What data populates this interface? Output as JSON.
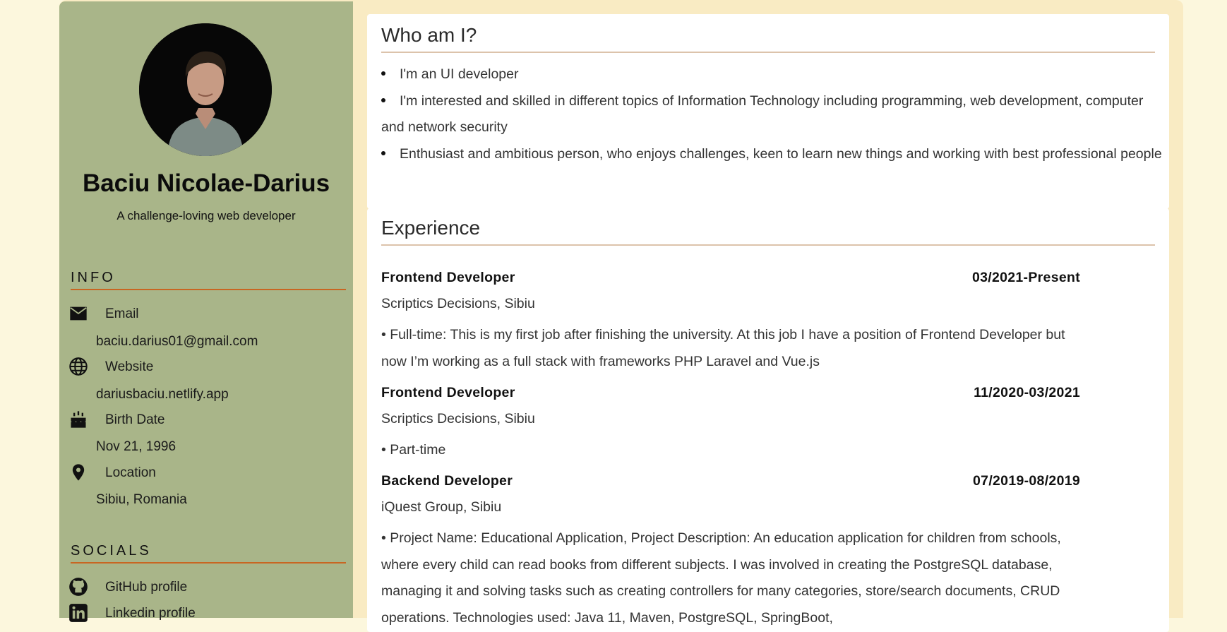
{
  "profile": {
    "name": "Baciu Nicolae-Darius",
    "tagline": "A challenge-loving web developer"
  },
  "info": {
    "title": "INFO",
    "items": [
      {
        "icon": "mail-icon",
        "label": "Email",
        "value": "baciu.darius01@gmail.com"
      },
      {
        "icon": "globe-icon",
        "label": "Website",
        "value": "dariusbaciu.netlify.app"
      },
      {
        "icon": "cake-icon",
        "label": "Birth Date",
        "value": "Nov 21, 1996"
      },
      {
        "icon": "location-pin-icon",
        "label": "Location",
        "value": "Sibiu, Romania"
      }
    ]
  },
  "socials": {
    "title": "SOCIALS",
    "items": [
      {
        "icon": "github-icon",
        "label": "GitHub profile"
      },
      {
        "icon": "linkedin-icon",
        "label": "Linkedin profile"
      }
    ]
  },
  "about": {
    "title": "Who am I?",
    "bullets": [
      "I'm an UI developer",
      "I'm interested and skilled in different topics of Information Technology including programming, web development, computer and network security",
      "Enthusiast and ambitious person, who enjoys challenges, keen to learn new things and working with best professional people"
    ]
  },
  "experience": {
    "title": "Experience",
    "jobs": [
      {
        "title": "Frontend Developer",
        "date": "03/2021-Present",
        "company": "Scriptics Decisions, Sibiu",
        "description": "• Full-time: This is my first job after finishing the university. At this job I have a position of Frontend Developer but now I’m working as a full stack with frameworks PHP Laravel and Vue.js"
      },
      {
        "title": "Frontend Developer",
        "date": "11/2020-03/2021",
        "company": "Scriptics Decisions, Sibiu",
        "description": "• Part-time"
      },
      {
        "title": "Backend Developer",
        "date": "07/2019-08/2019",
        "company": "iQuest Group, Sibiu",
        "description": "• Project Name: Educational Application, Project Description: An education application for children from schools, where every child can read books from different subjects. I was involved in creating the PostgreSQL database, managing it and solving tasks such as creating controllers for many categories, store/search documents, CRUD operations. Technologies used: Java 11, Maven, PostgreSQL, SpringBoot,"
      }
    ]
  },
  "colors": {
    "page_background": "#fcf7dd",
    "frame_background": "#f9ebc3",
    "sidebar_background": "#a9b589",
    "section_underline": "#c86622",
    "card_underline": "#dcc3ab"
  }
}
